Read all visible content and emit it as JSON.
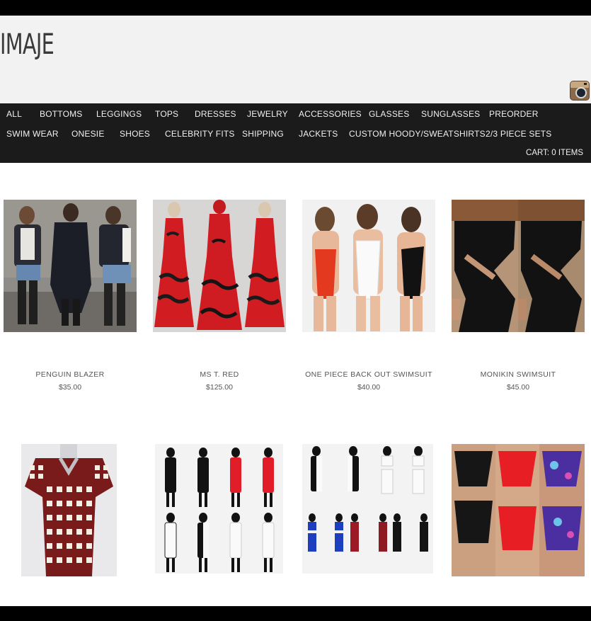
{
  "site": {
    "logo": "IMAJE"
  },
  "nav": {
    "row1": [
      "ALL",
      "BOTTOMS",
      "LEGGINGS",
      "TOPS",
      "DRESSES",
      "JEWELRY",
      "ACCESSORIES",
      "GLASSES",
      "SUNGLASSES",
      "PREORDER"
    ],
    "row2": [
      "SWIM WEAR",
      "ONESIE",
      "SHOES",
      "CELEBRITY FITS",
      "SHIPPING",
      "JACKETS",
      "CUSTOM HOODY/SWEATSHIRTS",
      "2/3 PIECE SETS"
    ],
    "cart": "CART: 0 ITEMS"
  },
  "products": [
    {
      "name": "PENGUIN BLAZER",
      "price": "$35.00"
    },
    {
      "name": "MS T. RED",
      "price": "$125.00"
    },
    {
      "name": "ONE PIECE BACK OUT SWIMSUIT",
      "price": "$40.00"
    },
    {
      "name": "MONIKIN SWIMSUIT",
      "price": "$45.00"
    }
  ],
  "icons": {
    "social": "instagram-icon"
  },
  "colors": {
    "nav_bg": "#1b1b1b",
    "header_bg": "#f2f2f2",
    "bar": "#000000"
  }
}
